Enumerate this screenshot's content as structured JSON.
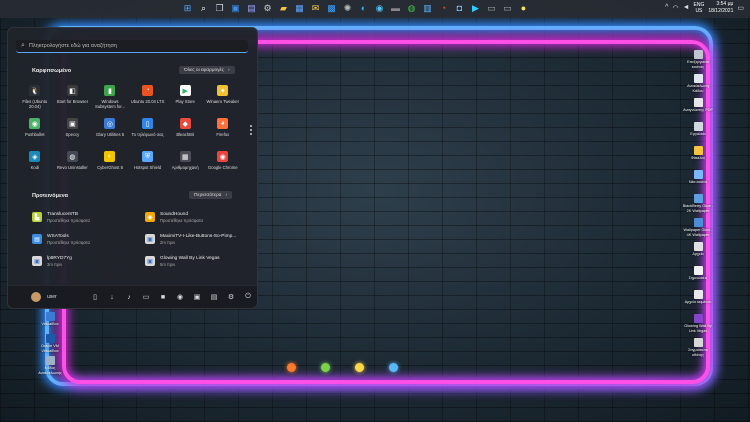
{
  "taskbar": {
    "icons": [
      {
        "name": "start-icon",
        "glyph": "⊞",
        "color": "#4aa8ff"
      },
      {
        "name": "search-icon",
        "glyph": "⌕",
        "color": "#ffffff"
      },
      {
        "name": "task-view-icon",
        "glyph": "❐",
        "color": "#cfd8e3"
      },
      {
        "name": "widgets-icon",
        "glyph": "▣",
        "color": "#3e8ee8"
      },
      {
        "name": "chat-icon",
        "glyph": "▤",
        "color": "#9aa6ff"
      },
      {
        "name": "settings-icon",
        "glyph": "⚙",
        "color": "#cccccc"
      },
      {
        "name": "explorer-icon",
        "glyph": "▰",
        "color": "#f5c542"
      },
      {
        "name": "notepad-icon",
        "glyph": "▦",
        "color": "#60a5ff"
      },
      {
        "name": "mail-icon",
        "glyph": "✉",
        "color": "#ffd54a"
      },
      {
        "name": "store-icon",
        "glyph": "▩",
        "color": "#3aa0ff"
      },
      {
        "name": "gear-app-icon",
        "glyph": "✺",
        "color": "#bbbbbb"
      },
      {
        "name": "edge-icon",
        "glyph": "◐",
        "color": "#2fb7e8"
      },
      {
        "name": "browser-icon",
        "glyph": "◉",
        "color": "#4fc3f7"
      },
      {
        "name": "terminal-icon",
        "glyph": "▬",
        "color": "#888888"
      },
      {
        "name": "xbox-icon",
        "glyph": "◍",
        "color": "#46c24a"
      },
      {
        "name": "photos-icon",
        "glyph": "▥",
        "color": "#5fb8ff"
      },
      {
        "name": "ubuntu-icon",
        "glyph": "◔",
        "color": "#e95420"
      },
      {
        "name": "tool-icon",
        "glyph": "◘",
        "color": "#7ec8ff"
      },
      {
        "name": "media-player-icon",
        "glyph": "▶",
        "color": "#2fd0ff"
      },
      {
        "name": "window-icon",
        "glyph": "▭",
        "color": "#aaaaaa"
      },
      {
        "name": "display-icon",
        "glyph": "▭",
        "color": "#aaaaaa"
      },
      {
        "name": "bulb-icon",
        "glyph": "●",
        "color": "#ffe066"
      }
    ],
    "tray": {
      "chevron": "^",
      "lang_top": "ENG",
      "lang_bottom": "US",
      "time": "3:54 μμ",
      "date": "18/12/2021"
    }
  },
  "start_menu": {
    "search_placeholder": "Πληκτρολογήστε εδώ για αναζήτηση",
    "pinned_title": "Καρφιτσωμένο",
    "all_apps_label": "Όλες οι εφαρμογές",
    "pinned": [
      {
        "label": "Files (Ubuntu 20.04)",
        "glyph": "🐧",
        "bg": "#2b2f36",
        "icon": "tux-icon"
      },
      {
        "label": "Start for Browser",
        "glyph": "◧",
        "bg": "#3a3a3a",
        "icon": "start-browser-icon"
      },
      {
        "label": "Windows Subsystem for...",
        "glyph": "▮",
        "bg": "#3ea34a",
        "icon": "wsa-icon"
      },
      {
        "label": "Ubuntu 20.04 LTS",
        "glyph": "◔",
        "bg": "#e95420",
        "icon": "ubuntu-icon"
      },
      {
        "label": "Play Store",
        "glyph": "▶",
        "bg": "#ffffff",
        "icon": "play-store-icon"
      },
      {
        "label": "Winaero Tweaker",
        "glyph": "✦",
        "bg": "#f0c030",
        "icon": "winaero-icon"
      },
      {
        "label": "Pushbullet",
        "glyph": "◉",
        "bg": "#4ab367",
        "icon": "pushbullet-icon"
      },
      {
        "label": "Speccy",
        "glyph": "▣",
        "bg": "#444444",
        "icon": "speccy-icon"
      },
      {
        "label": "Glary Utilities 5",
        "glyph": "◎",
        "bg": "#3a7bd5",
        "icon": "glary-icon"
      },
      {
        "label": "Το τηλέφωνό σας",
        "glyph": "▯",
        "bg": "#2f86e8",
        "icon": "phone-icon"
      },
      {
        "label": "BleachBit",
        "glyph": "◆",
        "bg": "#e94b3c",
        "icon": "bleachbit-icon"
      },
      {
        "label": "Firefox",
        "glyph": "◕",
        "bg": "#ff7139",
        "icon": "firefox-icon"
      },
      {
        "label": "Kodi",
        "glyph": "◈",
        "bg": "#1b8ab8",
        "icon": "kodi-icon"
      },
      {
        "label": "Revo Uninstaller",
        "glyph": "◍",
        "bg": "#444a55",
        "icon": "revo-icon"
      },
      {
        "label": "CyberGhost 8",
        "glyph": "◐",
        "bg": "#f2c500",
        "icon": "cyberghost-icon"
      },
      {
        "label": "Hotspot Shield",
        "glyph": "⛨",
        "bg": "#5aa7ff",
        "icon": "shield-icon"
      },
      {
        "label": "Αριθμομηχανή",
        "glyph": "▦",
        "bg": "#4a4d55",
        "icon": "calculator-icon"
      },
      {
        "label": "Google Chrome",
        "glyph": "◉",
        "bg": "#e8453c",
        "icon": "chrome-icon"
      }
    ],
    "recommended_title": "Προτεινόμενα",
    "more_label": "Περισσότερα",
    "recommended": [
      {
        "name": "TranslucentTB",
        "sub": "Προστέθηκε πρόσφατα",
        "glyph": "▙",
        "bg": "#b6d334",
        "icon": "translucenttb-icon"
      },
      {
        "name": "SoundHound",
        "sub": "Προστέθηκε πρόσφατα",
        "glyph": "◉",
        "bg": "#f2a900",
        "icon": "soundhound-icon"
      },
      {
        "name": "WSATools",
        "sub": "Προστέθηκε πρόσφατα",
        "glyph": "▤",
        "bg": "#3a8ce0",
        "icon": "wsatools-icon"
      },
      {
        "name": "MaximiTV-I-Like-Buttons-So-Pimp...",
        "sub": "2m πριν",
        "glyph": "▣",
        "bg": "#d8d8d8",
        "icon": "image-file-icon"
      },
      {
        "name": "lp8RYD7Yg",
        "sub": "3m πριν",
        "glyph": "▣",
        "bg": "#d8d8d8",
        "icon": "file-icon"
      },
      {
        "name": "Glowing Wall By Link Vegas",
        "sub": "5m πριν",
        "glyph": "▣",
        "bg": "#d8d8d8",
        "icon": "wallpaper-file-icon"
      }
    ],
    "user": "user",
    "footer_icons": [
      {
        "name": "documents-icon",
        "glyph": "▯"
      },
      {
        "name": "downloads-icon",
        "glyph": "↓"
      },
      {
        "name": "music-icon",
        "glyph": "♪"
      },
      {
        "name": "pictures-icon",
        "glyph": "▭"
      },
      {
        "name": "videos-icon",
        "glyph": "■"
      },
      {
        "name": "network-icon",
        "glyph": "◉"
      },
      {
        "name": "personal-folder-icon",
        "glyph": "▣"
      },
      {
        "name": "file-explorer-icon",
        "glyph": "▤"
      },
      {
        "name": "settings-icon",
        "glyph": "⚙"
      },
      {
        "name": "power-icon",
        "glyph": "⏻"
      }
    ]
  },
  "desktop": {
    "right_icons": [
      {
        "label": "Επεξεργασία εικόνας",
        "bg": "#c0c4cc",
        "icon": "image-editor-icon"
      },
      {
        "label": "Ανακύκλωση Κάδου",
        "bg": "#dfe6ee",
        "icon": "recycle-bin-icon"
      },
      {
        "label": "Αναγνώστης PDF",
        "bg": "#e6e6e6",
        "icon": "pdf-icon"
      },
      {
        "label": "Εργαλεία",
        "bg": "#cfd8dc",
        "icon": "tools-icon"
      },
      {
        "label": "Φάκελος",
        "bg": "#f5c542",
        "icon": "folder-icon"
      },
      {
        "label": "Νέα εικόνα",
        "bg": "#7ab8ff",
        "icon": "picture-icon"
      },
      {
        "label": "BlackBerry Glow - 2K Wallpaper",
        "bg": "#5aa0e0",
        "icon": "wallpaper-icon"
      },
      {
        "label": "Wallpaper Glow - 4K Wallpaper",
        "bg": "#4a8fd6",
        "icon": "wallpaper-4k-icon"
      },
      {
        "label": "Αρχείο",
        "bg": "#e0e0e0",
        "icon": "document-icon"
      },
      {
        "label": "Σημειώσεις",
        "bg": "#f0f0f0",
        "icon": "notes-icon"
      },
      {
        "label": "Αρχείο κειμένου",
        "bg": "#e8e8e8",
        "icon": "text-file-icon"
      },
      {
        "label": "Glowing Wall By Link Vegas",
        "bg": "#8844cc",
        "icon": "glowing-wall-icon"
      },
      {
        "label": "Στιγμιότυπο οθόνης",
        "bg": "#d6d6d6",
        "icon": "screenshot-icon"
      }
    ],
    "left_icons": [
      {
        "label": "VirtualBox",
        "bg": "#3a7bd5",
        "icon": "virtualbox-icon"
      },
      {
        "label": "Oracle VM VirtualBox",
        "bg": "#1a5aa8",
        "icon": "oracle-vm-icon"
      },
      {
        "label": "Κάδος Ανακύκλωσης",
        "bg": "#9fb3c8",
        "icon": "bin-icon"
      }
    ],
    "bottom_icons": [
      {
        "name": "balloon-orange-icon",
        "color": "#ff7a2a"
      },
      {
        "name": "balloon-green-icon",
        "color": "#7ad34a"
      },
      {
        "name": "balloon-yellow-icon",
        "color": "#ffd84a"
      },
      {
        "name": "balloon-blue-icon",
        "color": "#5ab8ff"
      }
    ]
  }
}
